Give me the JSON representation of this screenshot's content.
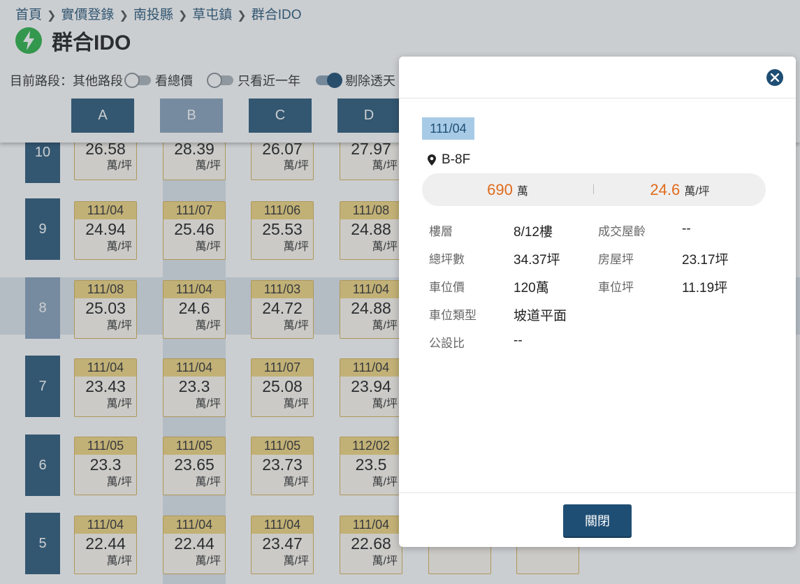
{
  "breadcrumb": [
    "首頁",
    "實價登錄",
    "南投縣",
    "草屯鎮",
    "群合IDO"
  ],
  "title": "群合IDO",
  "filters": {
    "road_label": "目前路段：其他路段",
    "total_price_label": "看總價",
    "recent_year_label": "只看近一年",
    "exclude_label": "剔除透天"
  },
  "columns": [
    "A",
    "B",
    "C",
    "D"
  ],
  "floors": [
    "10",
    "9",
    "8",
    "7",
    "6",
    "5"
  ],
  "unit": "萬/坪",
  "cells": {
    "r10": [
      {
        "date": "",
        "price": "26.58"
      },
      {
        "date": "",
        "price": "28.39"
      },
      {
        "date": "",
        "price": "26.07"
      },
      {
        "date": "",
        "price": "27.97"
      }
    ],
    "r9": [
      {
        "date": "111/04",
        "price": "24.94"
      },
      {
        "date": "111/07",
        "price": "25.46"
      },
      {
        "date": "111/06",
        "price": "25.53"
      },
      {
        "date": "111/08",
        "price": "24.88"
      }
    ],
    "r8": [
      {
        "date": "111/08",
        "price": "25.03"
      },
      {
        "date": "111/04",
        "price": "24.6"
      },
      {
        "date": "111/03",
        "price": "24.72"
      },
      {
        "date": "111/04",
        "price": "24.88"
      }
    ],
    "r7": [
      {
        "date": "111/04",
        "price": "23.43"
      },
      {
        "date": "111/04",
        "price": "23.3"
      },
      {
        "date": "111/07",
        "price": "25.08"
      },
      {
        "date": "111/04",
        "price": "23.94"
      }
    ],
    "r6": [
      {
        "date": "111/05",
        "price": "23.3"
      },
      {
        "date": "111/05",
        "price": "23.65"
      },
      {
        "date": "111/05",
        "price": "23.73"
      },
      {
        "date": "112/02",
        "price": "23.5"
      }
    ],
    "r5": [
      {
        "date": "111/04",
        "price": "22.44"
      },
      {
        "date": "111/04",
        "price": "22.44"
      },
      {
        "date": "111/04",
        "price": "23.47"
      },
      {
        "date": "111/04",
        "price": "22.68"
      }
    ]
  },
  "modal": {
    "date": "111/04",
    "location": "B-8F",
    "total_price": "690",
    "total_price_unit": "萬",
    "unit_price": "24.6",
    "unit_price_unit": "萬/坪",
    "details": {
      "floor_label": "樓層",
      "floor_value": "8/12樓",
      "age_label": "成交屋齡",
      "age_value": "--",
      "total_area_label": "總坪數",
      "total_area_value": "34.37坪",
      "house_area_label": "房屋坪",
      "house_area_value": "23.17坪",
      "parking_price_label": "車位價",
      "parking_price_value": "120萬",
      "parking_area_label": "車位坪",
      "parking_area_value": "11.19坪",
      "parking_type_label": "車位類型",
      "parking_type_value": "坡道平面",
      "public_ratio_label": "公設比",
      "public_ratio_value": "--"
    },
    "close_label": "關閉"
  },
  "colors": {
    "primary": "#2d5a7b",
    "accent_orange": "#e06b1c",
    "cell_date_bg": "#f3d782",
    "chip_bg": "#a7cbe6"
  }
}
